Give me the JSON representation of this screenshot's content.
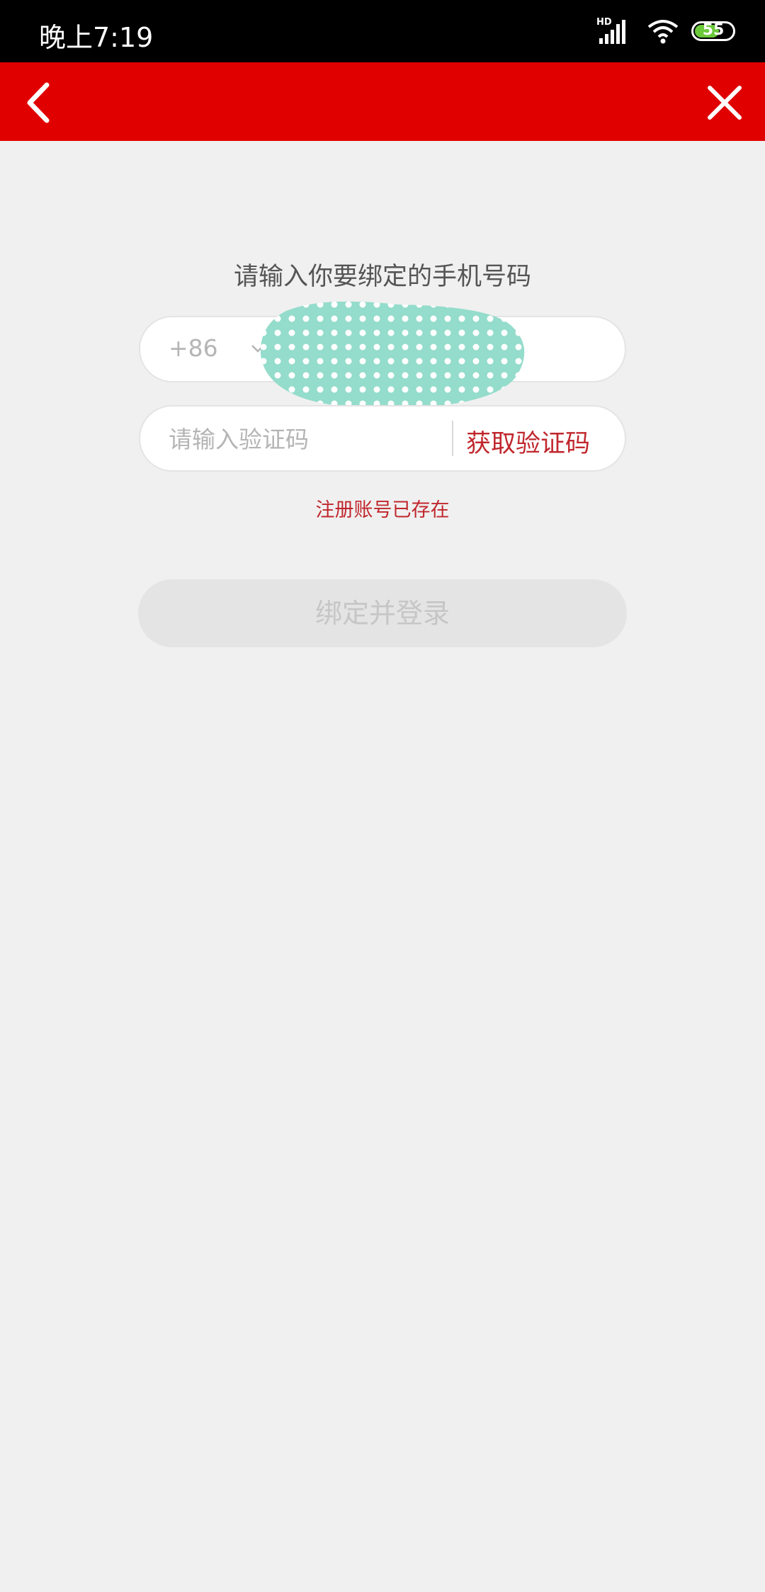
{
  "status_bar": {
    "time": "晚上7:19",
    "network_label": "HD",
    "battery_level": "55",
    "battery_color": "#6bc93a"
  },
  "app_bar": {
    "background": "#e00000",
    "back_icon": "chevron-left-icon",
    "close_icon": "close-icon"
  },
  "form": {
    "heading": "请输入你要绑定的手机号码",
    "phone": {
      "country_code": "+86",
      "dropdown_icon": "chevron-down-icon",
      "value_redacted": true
    },
    "code": {
      "placeholder": "请输入验证码",
      "get_code_label": "获取验证码"
    },
    "error_message": "注册账号已存在",
    "submit_label": "绑定并登录"
  },
  "colors": {
    "accent": "#c0272d",
    "page_background": "#f0f0f0"
  }
}
